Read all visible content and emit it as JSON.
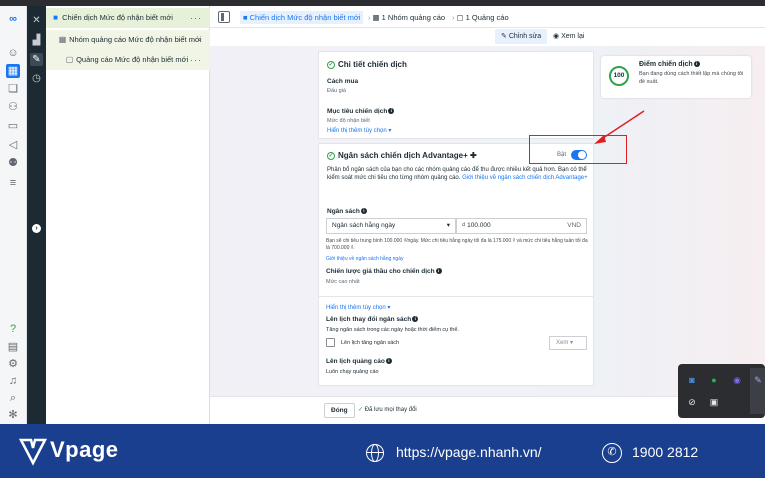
{
  "tree": {
    "campaign": "Chiến dịch Mức độ nhận biết mới",
    "adset": "Nhóm quảng cáo Mức độ nhận biết mới",
    "ad": "Quảng cáo Mức độ nhận biết mới",
    "more": "···"
  },
  "header": {
    "crumb_campaign": "Chiến dịch Mức độ nhận biết mới",
    "crumb_adset": "1 Nhóm quảng cáo",
    "crumb_ad": "1 Quảng cáo",
    "edit_label": "Chỉnh sửa",
    "view_label": "Xem lại"
  },
  "details": {
    "title": "Chi tiết chiến dịch",
    "buying_label": "Cách mua",
    "buying_value": "Đấu giá",
    "objective_label": "Mục tiêu chiến dịch",
    "objective_value": "Mức độ nhận biết",
    "more_options": "Hiển thị thêm tùy chọn ▾"
  },
  "budget": {
    "title": "Ngân sách chiến dịch Advantage+ ✚",
    "switch_label": "Bật",
    "description": "Phân bổ ngân sách của bạn cho các nhóm quảng cáo để thu được nhiều kết quả hơn. Bạn có thể kiểm soát mức chi tiêu cho từng nhóm quảng cáo.",
    "learn_link": "Giới thiệu về ngân sách chiến dịch Advantage+",
    "budget_label": "Ngân sách",
    "budget_type": "Ngân sách hằng ngày",
    "amount": "₫ 100.000",
    "currency": "VND",
    "note": "Bạn sẽ chi tiêu trung bình 100.000 ₫/ngày. Mức chi tiêu hằng ngày tối đa là 175.000 ₫ và mức chi tiêu hằng tuần tối đa là 700.000 ₫.",
    "note_link": "Giới thiệu về ngân sách hằng ngày",
    "bid_label": "Chiến lược giá thầu cho chiến dịch",
    "bid_value": "Mức cao nhất",
    "more_options": "Hiển thị thêm tùy chọn ▾",
    "schedule_label": "Lên lịch thay đổi ngân sách",
    "schedule_desc": "Tăng ngân sách trong các ngày hoặc thời điểm cụ thể.",
    "schedule_check": "Lên lịch tăng ngân sách",
    "view_btn": "Xem ▾",
    "ad_schedule_label": "Lên lịch quảng cáo",
    "ad_schedule_value": "Luôn chạy quảng cáo"
  },
  "score": {
    "value": "100",
    "title": "Điểm chiến dịch",
    "desc": "Bạn đang dùng cách thiết lập mà chúng tôi đề xuất."
  },
  "footer": {
    "close": "Đóng",
    "saved": "Đã lưu mọi thay đổi"
  },
  "banner": {
    "brand": "Vpage",
    "website": "https://vpage.nhanh.vn/",
    "phone": "1900 2812"
  },
  "colors": {
    "accent": "#1877f2",
    "success": "#31a24c",
    "annotation": "#e02020",
    "banner": "#1b3f8f"
  }
}
